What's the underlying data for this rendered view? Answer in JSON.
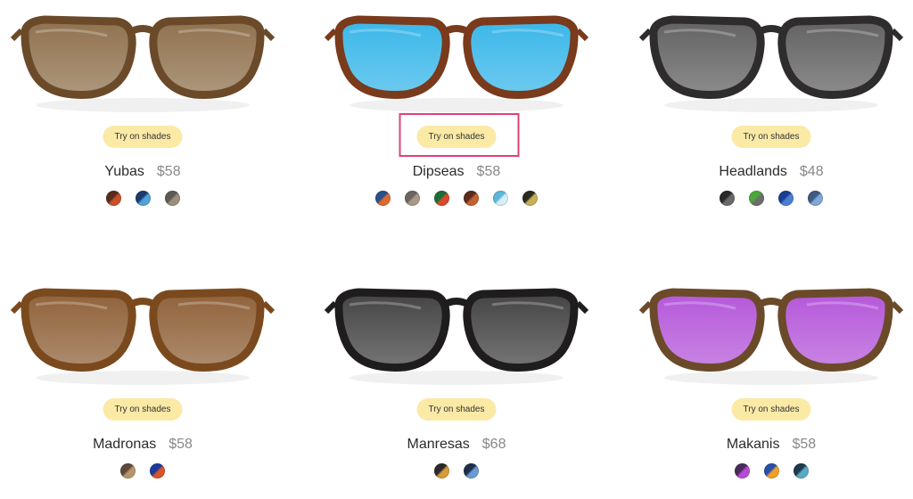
{
  "products": [
    {
      "name": "Yubas",
      "price": "$58",
      "button": "Try on shades",
      "frame_color": "#6b4a2a",
      "lens_color": "#8a6a45",
      "swatches": [
        [
          "#5a2c1e",
          "#c8512a"
        ],
        [
          "#1d3a6e",
          "#4fa3d6"
        ],
        [
          "#5d5a55",
          "#9c8f7c"
        ]
      ]
    },
    {
      "name": "Dipseas",
      "price": "$58",
      "button": "Try on shades",
      "frame_color": "#7a3a1c",
      "lens_color": "#2fb3e8",
      "swatches": [
        [
          "#2a4f8a",
          "#e06a2a"
        ],
        [
          "#6a6560",
          "#a89a86"
        ],
        [
          "#1e6b3a",
          "#d84a2a"
        ],
        [
          "#5a2c1e",
          "#c4612e"
        ],
        [
          "#5bb6d8",
          "#d8eef6"
        ],
        [
          "#2a2a20",
          "#c8b05a"
        ]
      ]
    },
    {
      "name": "Headlands",
      "price": "$48",
      "button": "Try on shades",
      "frame_color": "#2e2c2c",
      "lens_color": "#5a5a5a",
      "swatches": [
        [
          "#2a2a2a",
          "#6a6a6a"
        ],
        [
          "#4aa83a",
          "#6d6d6d"
        ],
        [
          "#1b3f8f",
          "#4b7fd4"
        ],
        [
          "#3f5a80",
          "#7fa8d8"
        ]
      ]
    },
    {
      "name": "Madronas",
      "price": "$58",
      "button": "Try on shades",
      "frame_color": "#7a4a1e",
      "lens_color": "#8a5a30",
      "swatches": [
        [
          "#5d4a3a",
          "#b8946a"
        ],
        [
          "#1d3a9a",
          "#d8542a"
        ]
      ]
    },
    {
      "name": "Manresas",
      "price": "$68",
      "button": "Try on shades",
      "frame_color": "#1e1c1c",
      "lens_color": "#3a3a3a",
      "swatches": [
        [
          "#2a2a2a",
          "#d89a3a"
        ],
        [
          "#1d2f4a",
          "#6a9ad4"
        ]
      ]
    },
    {
      "name": "Makanis",
      "price": "$58",
      "button": "Try on shades",
      "frame_color": "#6b4a2a",
      "lens_color": "#b14fd8",
      "swatches": [
        [
          "#4a2a5a",
          "#b84ad8"
        ],
        [
          "#2a4fa8",
          "#f0a02a"
        ],
        [
          "#1d3a4a",
          "#5aa8c8"
        ]
      ]
    }
  ],
  "highlighted_product": "Dipseas"
}
